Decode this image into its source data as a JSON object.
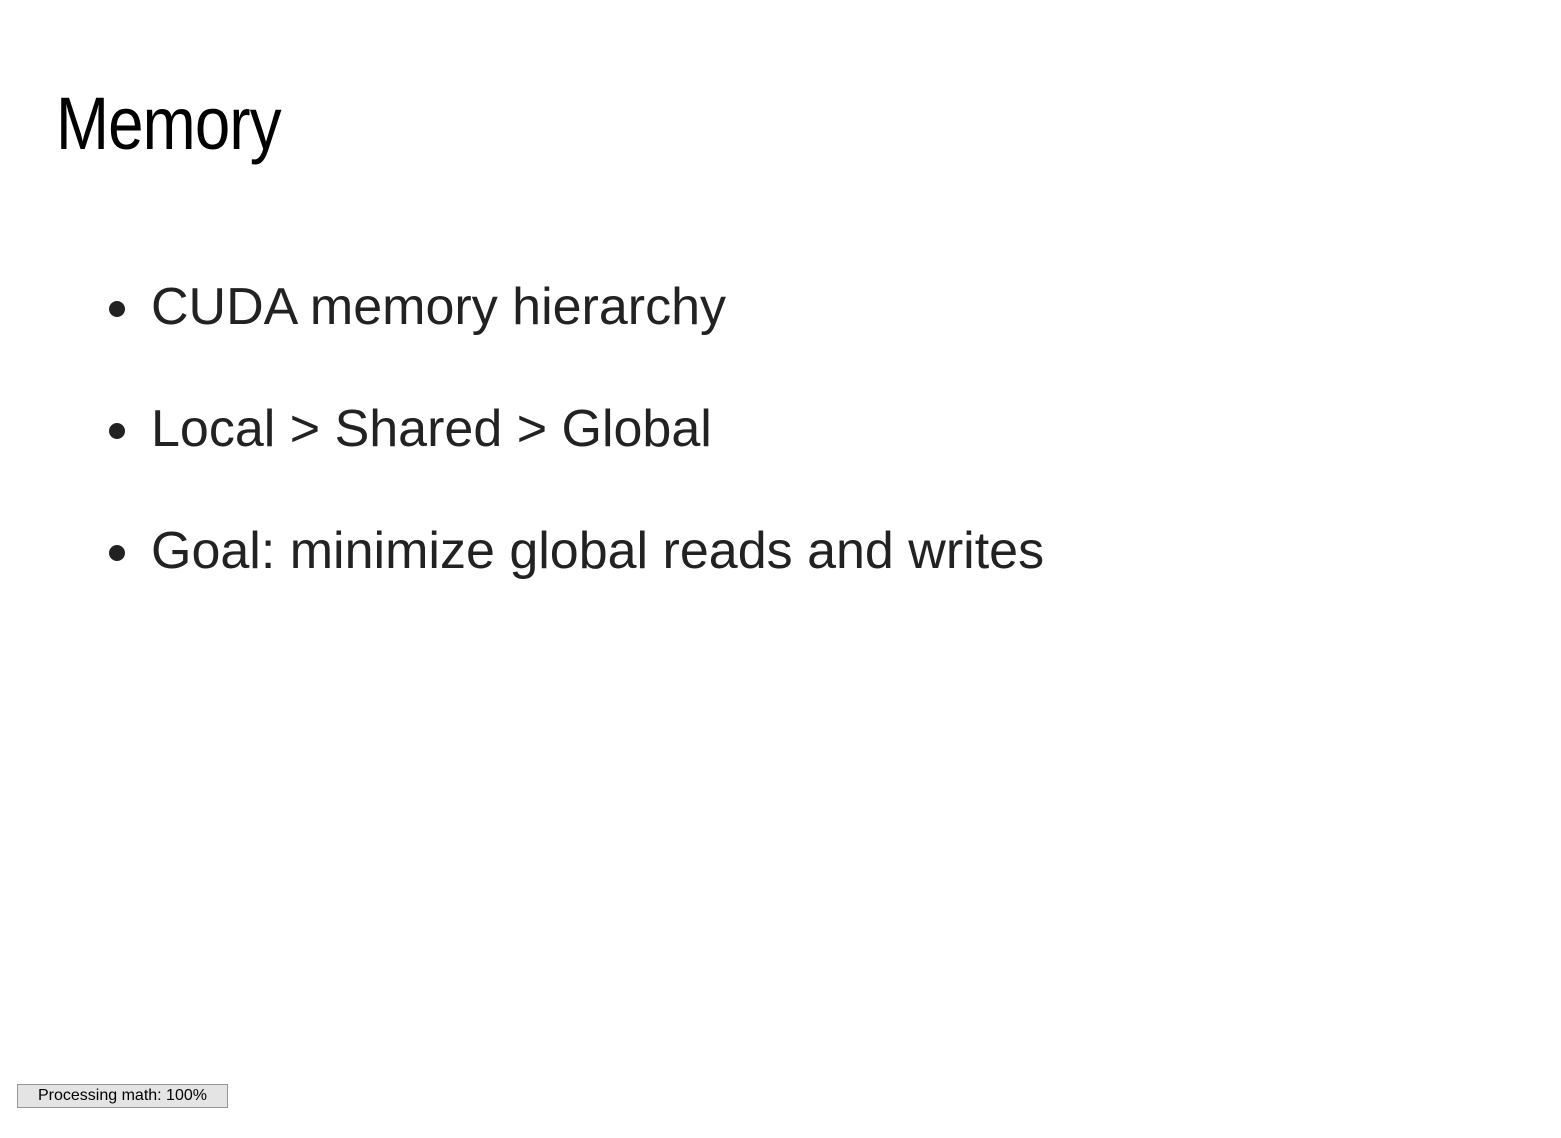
{
  "slide": {
    "title": "Memory",
    "bullets": [
      "CUDA memory hierarchy",
      "Local > Shared > Global",
      "Goal: minimize global reads and writes"
    ]
  },
  "status": {
    "text": "Processing math: 100%",
    "progress_percent": 100
  },
  "colors": {
    "background": "#ffffff",
    "title": "#000000",
    "body_text": "#222222",
    "status_bg": "#e4e4e4",
    "status_border": "#959595"
  }
}
